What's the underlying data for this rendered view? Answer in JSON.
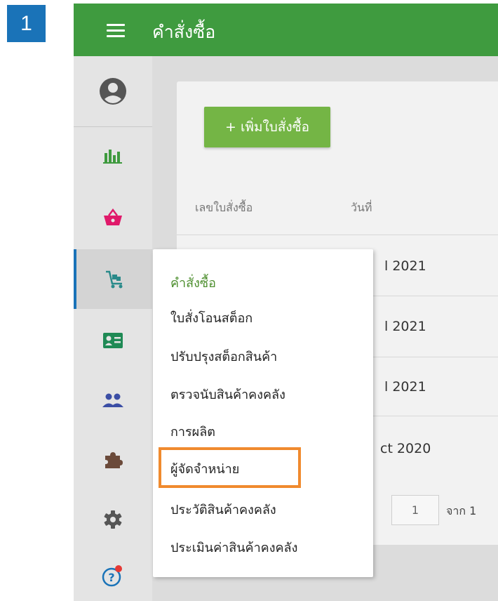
{
  "step_number": "1",
  "header": {
    "title": "คำสั่งซื้อ"
  },
  "sidebar": {
    "items": [
      {
        "name": "user-profile-icon",
        "color": "#555555"
      },
      {
        "name": "analytics-chart-icon",
        "color": "#3e9a3e"
      },
      {
        "name": "shopping-basket-icon",
        "color": "#e0196a"
      },
      {
        "name": "trolley-icon",
        "color": "#2a8a8a",
        "active": true
      },
      {
        "name": "contact-card-icon",
        "color": "#1f8a55"
      },
      {
        "name": "people-icon",
        "color": "#3b4ea5"
      },
      {
        "name": "puzzle-icon",
        "color": "#6b4a3a"
      },
      {
        "name": "gear-icon",
        "color": "#555555"
      },
      {
        "name": "help-icon",
        "color": "#1a73b8",
        "badge_color": "#e53935"
      }
    ]
  },
  "main": {
    "add_button_label": "+ เพิ่มใบสั่งซื้อ",
    "columns": [
      "เลขใบสั่งซื้อ",
      "วันที่"
    ],
    "rows": [
      "l 2021",
      "l 2021",
      "l 2021",
      "ct 2020"
    ],
    "pagination": {
      "current_page": "1",
      "of_label": "จาก 1"
    }
  },
  "menu": {
    "items": [
      "คำสั่งซื้อ",
      "ใบสั่งโอนสต็อก",
      "ปรับปรุงสต็อกสินค้า",
      "ตรวจนับสินค้าคงคลัง",
      "การผลิต",
      "ผู้จัดจำหน่าย",
      "ประวัติสินค้าคงคลัง",
      "ประเมินค่าสินค้าคงคลัง"
    ],
    "highlighted_item": "ผู้จัดจำหน่าย",
    "highlight_color": "#f08a2e"
  },
  "colors": {
    "header": "#3f9b3f",
    "accent": "#1a73b8",
    "button": "#74b545"
  }
}
